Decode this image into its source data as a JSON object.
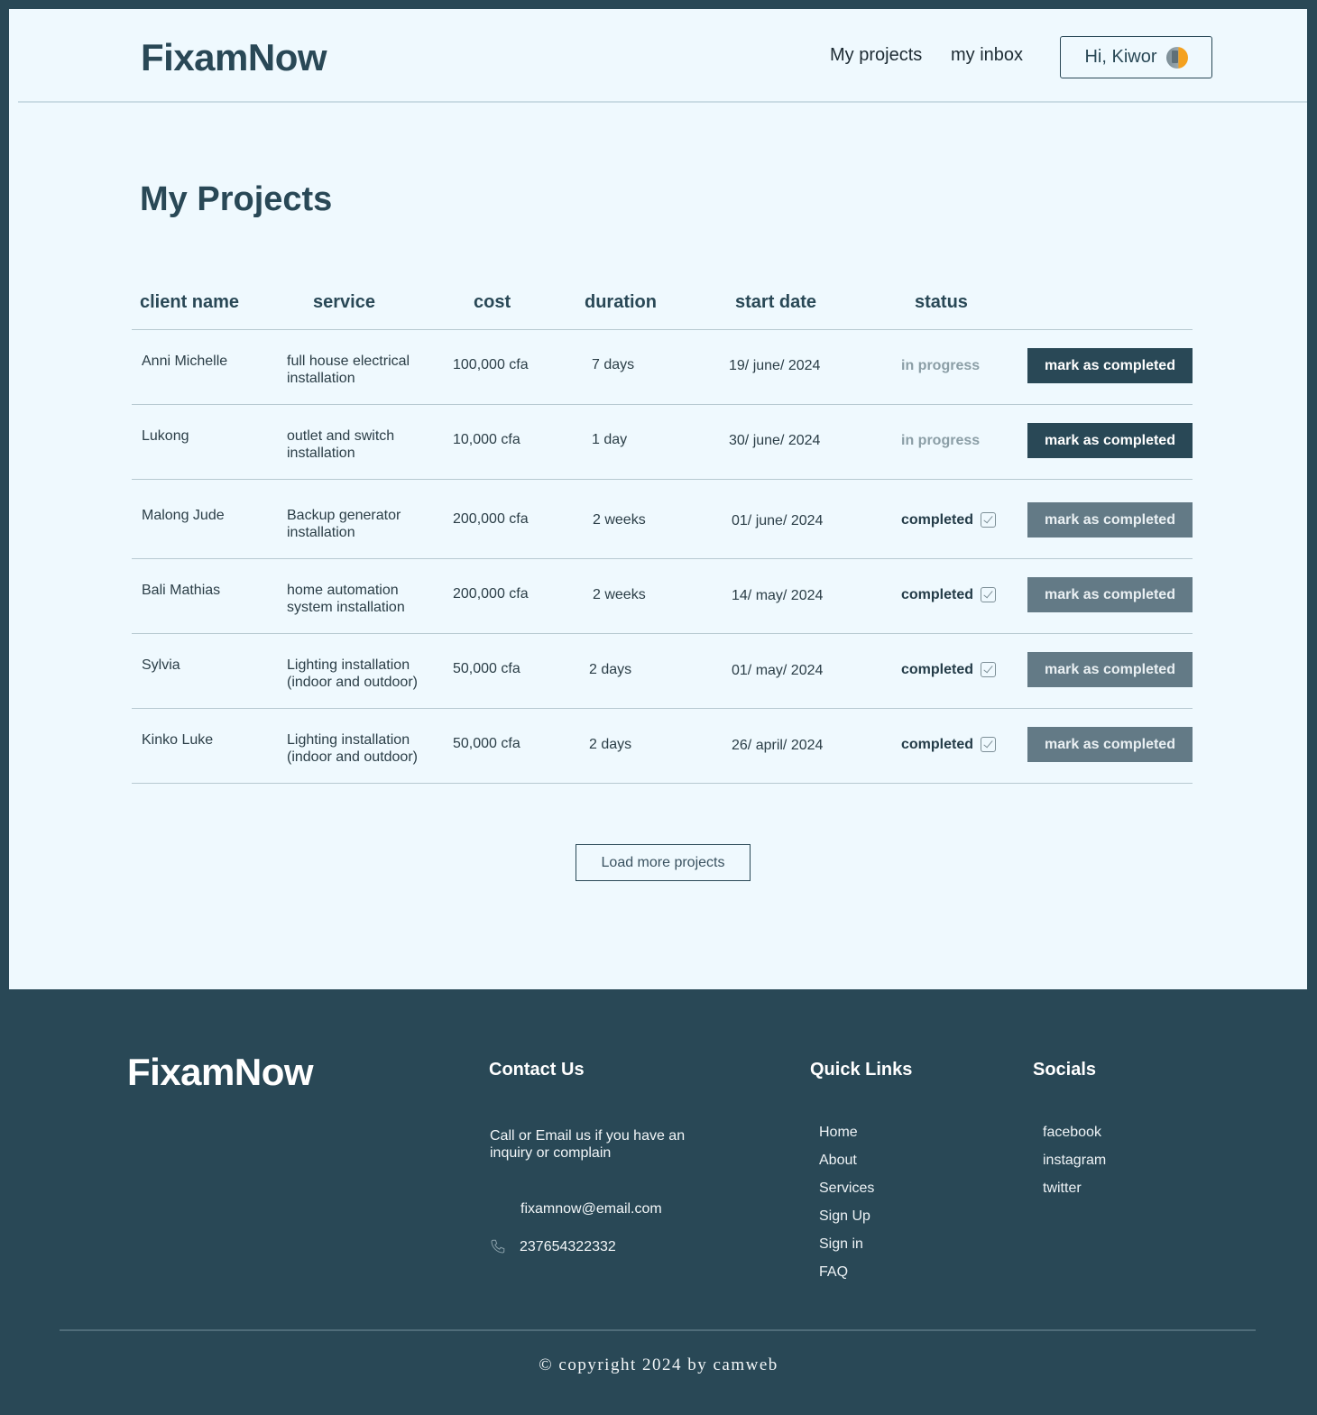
{
  "header": {
    "logo": "FixamNow",
    "nav": [
      {
        "label": "My projects"
      },
      {
        "label": "my inbox"
      }
    ],
    "user_greeting": "Hi, Kiwor",
    "avatar_icon": "user-avatar"
  },
  "main": {
    "title": "My Projects",
    "columns": [
      "client name",
      "service",
      "cost",
      "duration",
      "start date",
      "status"
    ],
    "rows": [
      {
        "client": "Anni Michelle",
        "service": "full house electrical installation",
        "cost": "100,000 cfa",
        "duration": "7 days",
        "start_date": "19/ june/ 2024",
        "status": "in progress",
        "action": "mark as completed"
      },
      {
        "client": "Lukong",
        "service": "outlet and switch installation",
        "cost": "10,000 cfa",
        "duration": "1 day",
        "start_date": "30/ june/ 2024",
        "status": "in progress",
        "action": "mark as completed"
      },
      {
        "client": "Malong Jude",
        "service": "Backup generator installation",
        "cost": "200,000 cfa",
        "duration": "2 weeks",
        "start_date": "01/ june/ 2024",
        "status": "completed",
        "action": "mark as completed"
      },
      {
        "client": "Bali Mathias",
        "service": "home automation system installation",
        "cost": "200,000 cfa",
        "duration": "2 weeks",
        "start_date": "14/ may/ 2024",
        "status": "completed",
        "action": "mark as completed"
      },
      {
        "client": "Sylvia",
        "service": "Lighting installation (indoor and outdoor)",
        "cost": "50,000 cfa",
        "duration": "2 days",
        "start_date": "01/ may/ 2024",
        "status": "completed",
        "action": "mark as completed"
      },
      {
        "client": "Kinko Luke",
        "service": "Lighting installation (indoor and outdoor)",
        "cost": "50,000 cfa",
        "duration": "2 days",
        "start_date": "26/ april/ 2024",
        "status": "completed",
        "action": "mark as completed"
      }
    ],
    "load_more": "Load more projects"
  },
  "footer": {
    "logo": "FixamNow",
    "contact": {
      "heading": "Contact Us",
      "text": "Call or Email us if you have an inquiry or complain",
      "email": "fixamnow@email.com",
      "phone": "237654322332"
    },
    "quick_links": {
      "heading": "Quick Links",
      "items": [
        "Home",
        "About",
        "Services",
        "Sign Up",
        "Sign in",
        "FAQ"
      ]
    },
    "socials": {
      "heading": "Socials",
      "items": [
        "facebook",
        "instagram",
        "twitter"
      ]
    },
    "copyright": "© copyright 2024 by camweb"
  },
  "colors": {
    "primary": "#294856",
    "page_bg": "#eff9fe",
    "button_disabled": "#637a86",
    "status_in_progress": "#8b9ea6"
  }
}
